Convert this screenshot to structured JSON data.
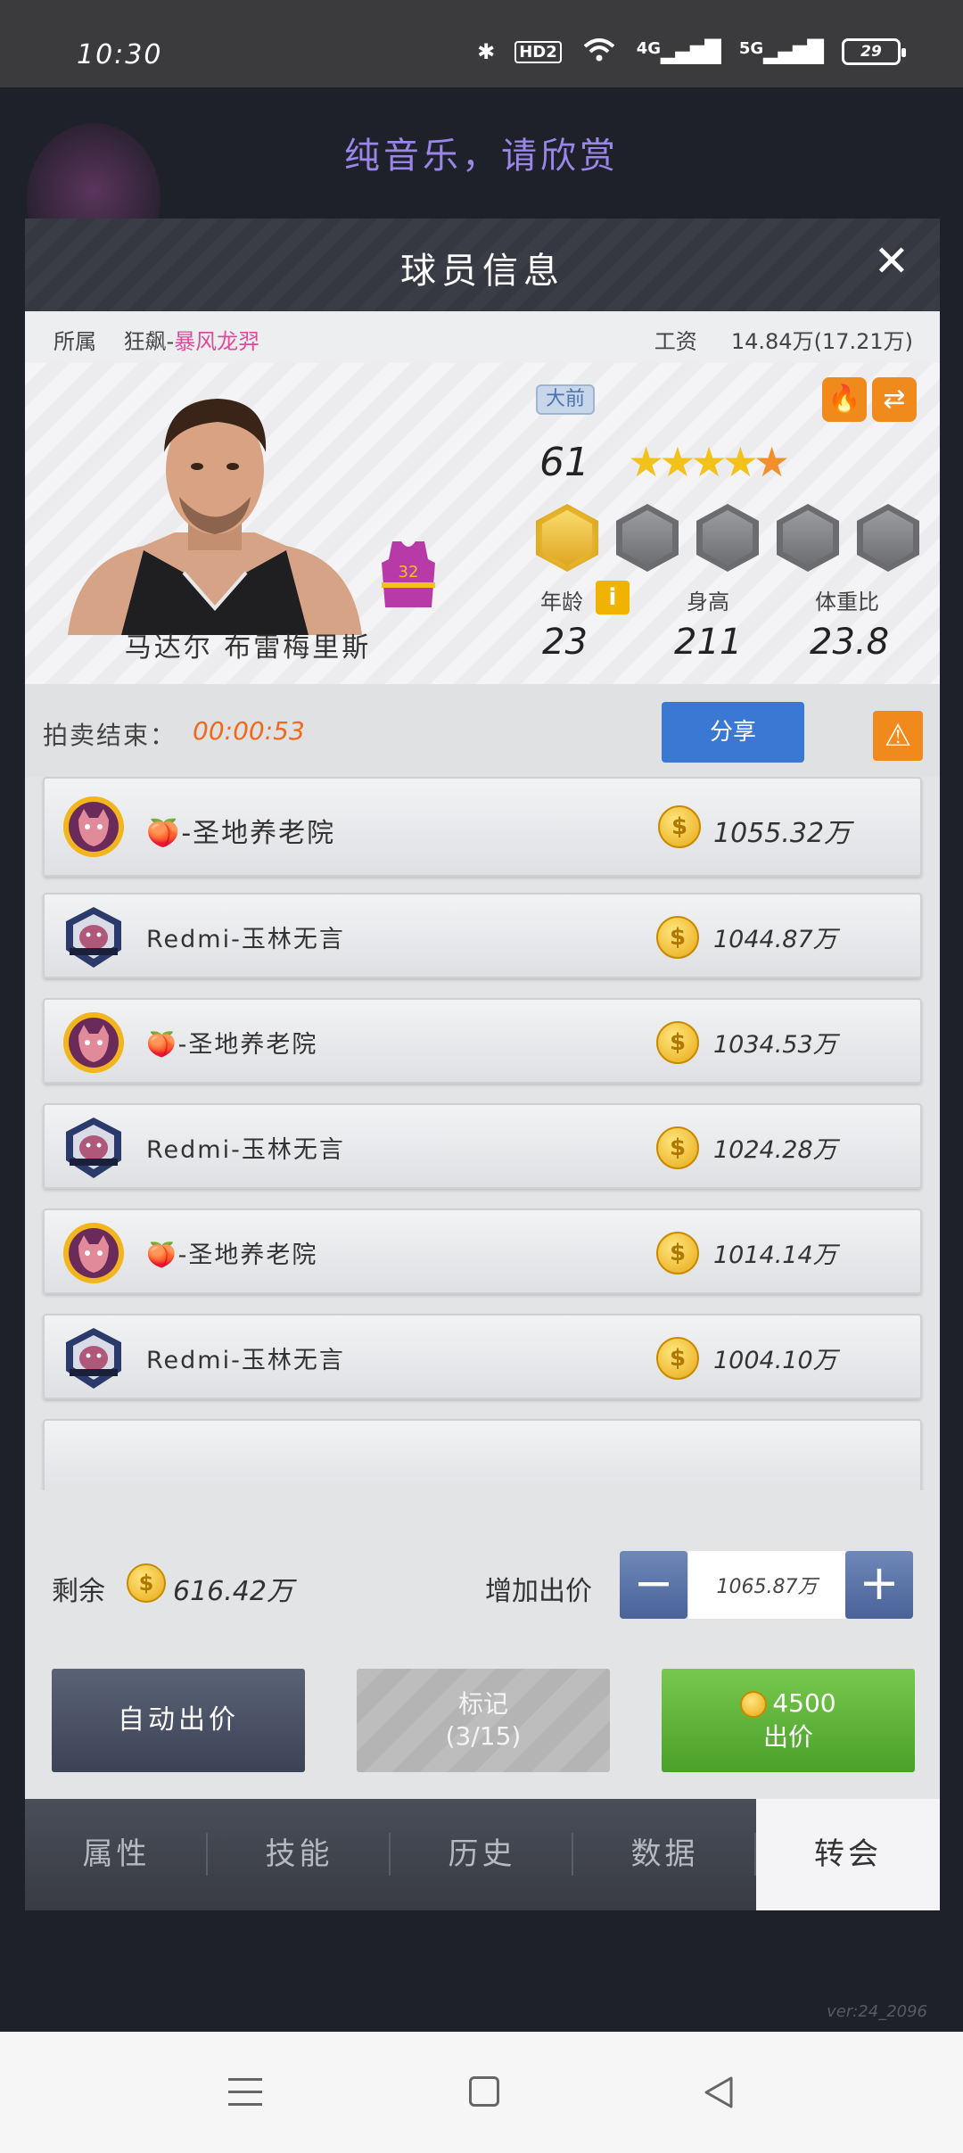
{
  "status": {
    "time": "10:30",
    "hd": "HD2",
    "net1": "4G",
    "net2": "5G",
    "battery": "29"
  },
  "background": {
    "music_text": "纯音乐，请欣赏",
    "version": "ver:24_2096"
  },
  "modal": {
    "title": "球员信息",
    "close": "✕",
    "belongs_label": "所属",
    "belongs_prefix": "狂飙-",
    "belongs_team": "暴风龙羿",
    "salary_label": "工资",
    "salary_value": "14.84万(17.21万)"
  },
  "player": {
    "name": "马达尔 布雷梅里斯",
    "jersey_number": "32",
    "position": "大前",
    "rating": "61",
    "stars": {
      "gold": 4,
      "orange": 1
    },
    "age_label": "年龄",
    "age": "23",
    "height_label": "身高",
    "height": "211",
    "weight_label": "体重比",
    "weight": "23.8",
    "info_icon": "i"
  },
  "auction": {
    "end_label": "拍卖结束：",
    "timer": "00:00:53",
    "share_label": "分享"
  },
  "bids": [
    {
      "team": "🍑-圣地养老院",
      "amount": "1055.32万",
      "logo": "tiger"
    },
    {
      "team": "Redmi-玉林无言",
      "amount": "1044.87万",
      "logo": "boar"
    },
    {
      "team": "🍑-圣地养老院",
      "amount": "1034.53万",
      "logo": "tiger"
    },
    {
      "team": "Redmi-玉林无言",
      "amount": "1024.28万",
      "logo": "boar"
    },
    {
      "team": "🍑-圣地养老院",
      "amount": "1014.14万",
      "logo": "tiger"
    },
    {
      "team": "Redmi-玉林无言",
      "amount": "1004.10万",
      "logo": "boar"
    }
  ],
  "controls": {
    "remain_label": "剩余",
    "remain_value": "616.42万",
    "raise_label": "增加出价",
    "raise_value": "1065.87万",
    "auto_bid_label": "自动出价",
    "mark_label": "标记",
    "mark_count": "(3/15)",
    "bid_cost": "4500",
    "bid_label": "出价"
  },
  "tabs": [
    "属性",
    "技能",
    "历史",
    "数据",
    "转会"
  ],
  "colors": {
    "accent_pink": "#e04a9a",
    "timer_orange": "#f06a1c",
    "share_blue": "#3a78d4",
    "bid_green": "#5bb236"
  }
}
